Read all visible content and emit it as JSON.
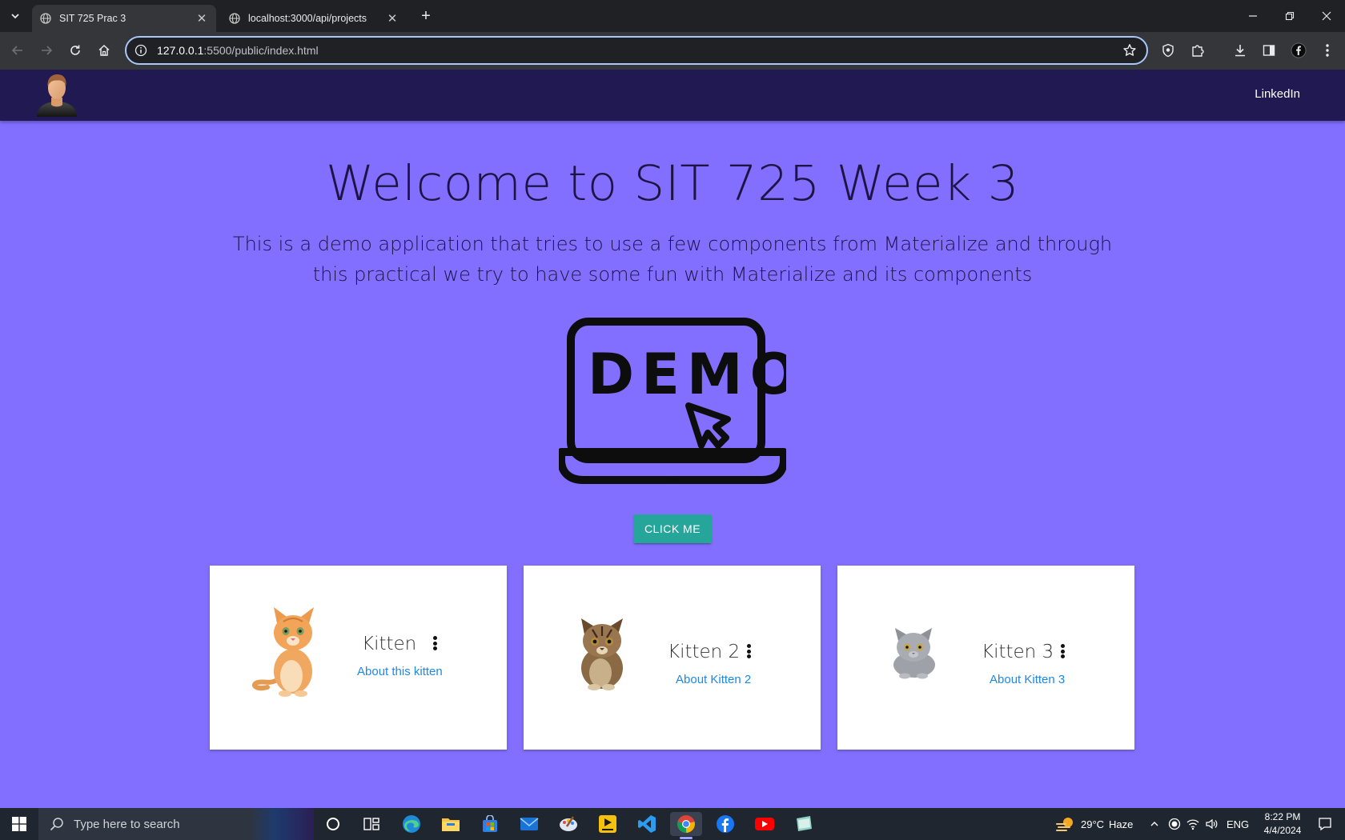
{
  "browser": {
    "tabs": [
      {
        "title": "SIT 725 Prac 3",
        "active": true
      },
      {
        "title": "localhost:3000/api/projects",
        "active": false
      }
    ],
    "url_host": "127.0.0.1",
    "url_path": ":5500/public/index.html"
  },
  "page": {
    "nav": {
      "link": "LinkedIn"
    },
    "hero": {
      "title": "Welcome to SIT 725 Week 3",
      "subtitle": "This is a demo application that tries to use a few components from Materialize and through this practical we try to have some fun with Materialize and its components"
    },
    "demo_image_text": "DEMO",
    "button": "CLICK ME",
    "cards": [
      {
        "title": "Kitten",
        "link": "About this kitten"
      },
      {
        "title": "Kitten 2",
        "link": "About Kitten 2"
      },
      {
        "title": "Kitten 3",
        "link": "About Kitten 3"
      }
    ]
  },
  "taskbar": {
    "search_placeholder": "Type here to search",
    "weather": "29°C",
    "weather_desc": "Haze",
    "lang": "ENG",
    "time": "8:22 PM",
    "date": "4/4/2024"
  },
  "colors": {
    "page_bg": "#836fff",
    "navbar_bg": "#211951",
    "button_bg": "#26a69a",
    "link": "#1e88e5"
  }
}
